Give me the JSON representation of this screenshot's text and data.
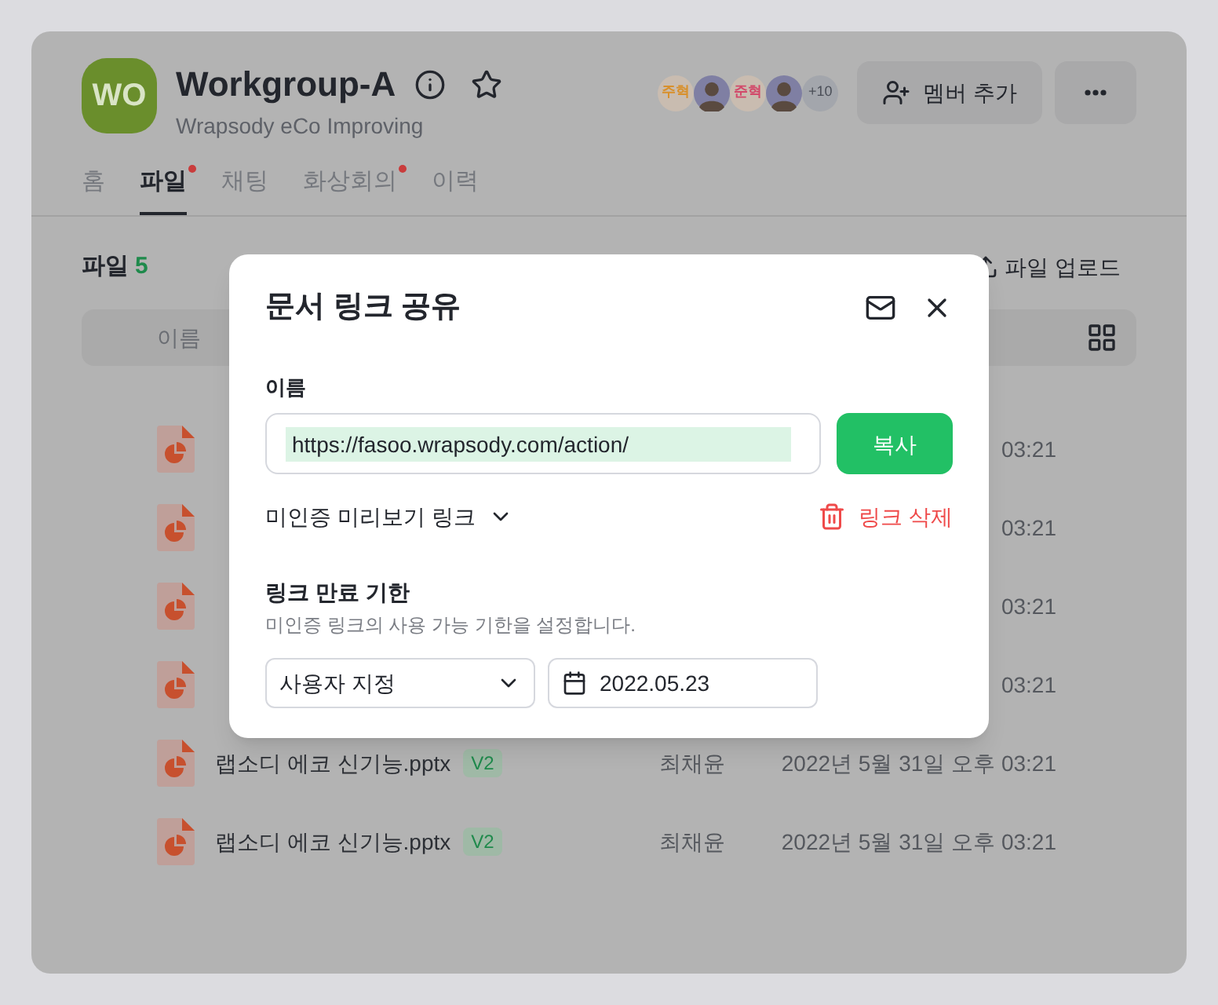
{
  "workgroup": {
    "initials": "WO",
    "name": "Workgroup-A",
    "subtitle": "Wrapsody eCo Improving"
  },
  "members": [
    {
      "kind": "initials",
      "label": "주혁",
      "color": "#d8902c"
    },
    {
      "kind": "photo"
    },
    {
      "kind": "initials",
      "label": "준혁",
      "color": "#d2496a"
    },
    {
      "kind": "photo"
    },
    {
      "kind": "count",
      "label": "+10"
    }
  ],
  "add_member_button": "멤버 추가",
  "tabs": [
    {
      "label": "홈",
      "selected": false,
      "badge": false
    },
    {
      "label": "파일",
      "selected": true,
      "badge": true
    },
    {
      "label": "채팅",
      "selected": false,
      "badge": false
    },
    {
      "label": "화상회의",
      "selected": false,
      "badge": true
    },
    {
      "label": "이력",
      "selected": false,
      "badge": false
    }
  ],
  "files": {
    "title": "파일",
    "count": "5",
    "upload_button": "파일 업로드",
    "columns": [
      "이름"
    ],
    "rows": [
      {
        "date": "03:21"
      },
      {
        "date": "03:21"
      },
      {
        "date": "03:21"
      },
      {
        "date": "03:21"
      },
      {
        "name": "랩소디 에코 신기능.pptx",
        "version": "V2",
        "author": "최채윤",
        "date": "2022년 5월 31일 오후 03:21"
      },
      {
        "name": "랩소디 에코 신기능.pptx",
        "version": "V2",
        "author": "최채윤",
        "date": "2022년 5월 31일 오후 03:21"
      }
    ]
  },
  "dialog": {
    "title": "문서 링크 공유",
    "name_label": "이름",
    "link": "https://fasoo.wrapsody.com/action/",
    "link_selected": true,
    "copy_button": "복사",
    "preview_dropdown": "미인증 미리보기 링크",
    "delete_button": "링크 삭제",
    "expiry_title": "링크 만료 기한",
    "expiry_description": "미인증 링크의 사용 가능 기한을 설정합니다.",
    "expiry_select": "사용자 지정",
    "expiry_date": "2022.05.23"
  }
}
